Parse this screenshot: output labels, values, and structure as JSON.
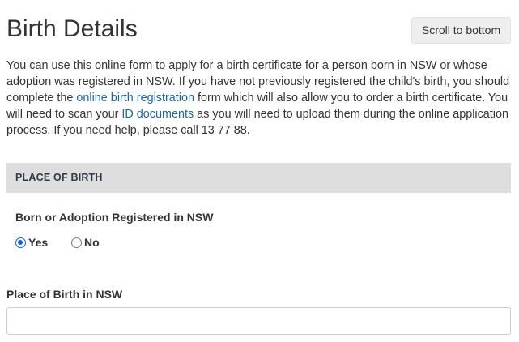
{
  "header": {
    "title": "Birth Details",
    "scroll_button_label": "Scroll to bottom"
  },
  "intro": {
    "text_1": "You can use this online form to apply for a birth certificate for a person born in NSW or whose adoption was registered in NSW. If you have not previously registered the child's birth, you should complete the ",
    "link_1": "online birth registration",
    "text_2": " form which will also allow you to order a birth certificate. You will need to scan your ",
    "link_2": "ID documents",
    "text_3": " as you will need to upload them during the online application process. If you need help, please call 13 77 88."
  },
  "section": {
    "title": "PLACE OF BIRTH"
  },
  "born_in_nsw": {
    "label": "Born or Adoption Registered in NSW",
    "options": [
      {
        "label": "Yes",
        "checked": true
      },
      {
        "label": "No",
        "checked": false
      }
    ]
  },
  "place_of_birth": {
    "label": "Place of Birth in NSW",
    "value": "",
    "placeholder": ""
  },
  "colors": {
    "link": "#1c67a8",
    "section_bar": "#dedede",
    "radio_checked": "#0b64d6"
  }
}
